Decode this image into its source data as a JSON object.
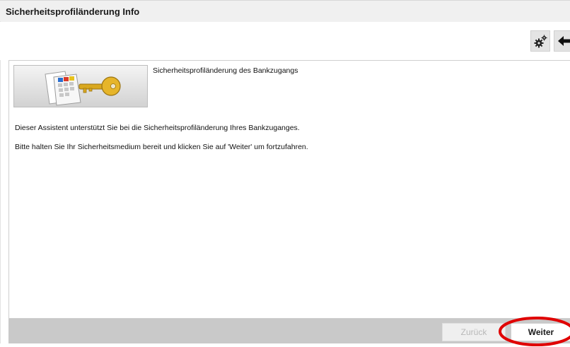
{
  "window": {
    "title": "Sicherheitsprofiländerung Info"
  },
  "toolbar": {
    "settings_icon": "gears-icon",
    "back_icon": "arrow-left-icon"
  },
  "content": {
    "banner_heading": "Sicherheitsprofiländerung des Bankzugangs",
    "banner_image": "security-card-key-illustration",
    "paragraph_1": "Dieser Assistent unterstützt Sie bei die Sicherheitsprofiländerung Ihres Bankzuganges.",
    "paragraph_2": "Bitte halten Sie Ihr Sicherheitsmedium bereit und klicken Sie auf 'Weiter' um fortzufahren."
  },
  "footer": {
    "back_label": "Zurück",
    "back_enabled": false,
    "next_label": "Weiter",
    "highlight_color": "#e00000"
  },
  "colors": {
    "footer_bg": "#c9c9c9",
    "title_bg": "#f0f0f0"
  }
}
